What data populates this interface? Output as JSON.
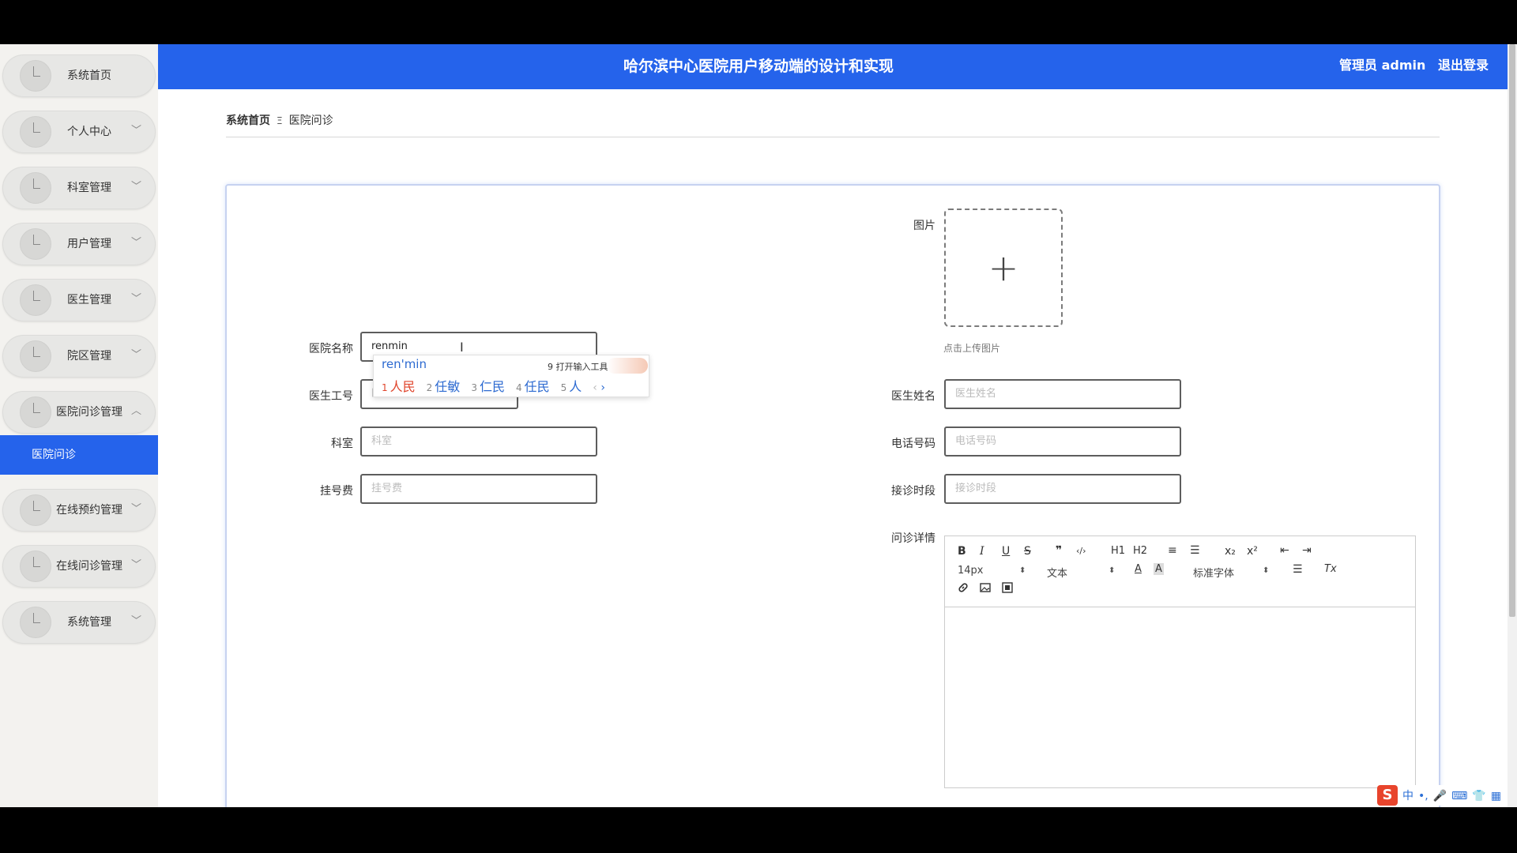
{
  "header": {
    "title": "哈尔滨中心医院用户移动端的设计和实现",
    "user": "管理员 admin",
    "logout": "退出登录"
  },
  "sidebar": {
    "items": [
      {
        "label": "系统首页",
        "chevron": ""
      },
      {
        "label": "个人中心",
        "chevron": "﹀"
      },
      {
        "label": "科室管理",
        "chevron": "﹀"
      },
      {
        "label": "用户管理",
        "chevron": "﹀"
      },
      {
        "label": "医生管理",
        "chevron": "﹀"
      },
      {
        "label": "院区管理",
        "chevron": "﹀"
      },
      {
        "label": "医院问诊管理",
        "chevron": "︿"
      },
      {
        "label": "在线预约管理",
        "chevron": "﹀"
      },
      {
        "label": "在线问诊管理",
        "chevron": "﹀"
      },
      {
        "label": "系统管理",
        "chevron": "﹀"
      }
    ],
    "active_sub": "医院问诊"
  },
  "breadcrumb": {
    "home": "系统首页",
    "separator": "Ξ",
    "current": "医院问诊"
  },
  "form": {
    "hospital_name": {
      "label": "医院名称",
      "value": "renmin"
    },
    "doctor_id": {
      "label": "医生工号",
      "placeholder": "医生工号"
    },
    "department": {
      "label": "科室",
      "placeholder": "科室"
    },
    "fee": {
      "label": "挂号费",
      "placeholder": "挂号费"
    },
    "image": {
      "label": "图片",
      "hint": "点击上传图片",
      "plus": "+"
    },
    "doctor_name": {
      "label": "医生姓名",
      "placeholder": "医生姓名"
    },
    "phone": {
      "label": "电话号码",
      "placeholder": "电话号码"
    },
    "time_slot": {
      "label": "接诊时段",
      "placeholder": "接诊时段"
    },
    "details": {
      "label": "问诊详情"
    }
  },
  "ime": {
    "pinyin": "ren'min",
    "toolbox": "9 打开输入工具箱",
    "candidates": [
      {
        "num": "1",
        "text": "人民"
      },
      {
        "num": "2",
        "text": "任敏"
      },
      {
        "num": "3",
        "text": "仁民"
      },
      {
        "num": "4",
        "text": "任民"
      },
      {
        "num": "5",
        "text": "人"
      }
    ],
    "prev": "‹",
    "next": "›"
  },
  "editor": {
    "toolbar_row1": [
      "B",
      "I",
      "U",
      "S",
      "❞",
      "‹/›",
      "H1",
      "H2",
      "≡",
      "☰",
      "x₂",
      "x²",
      "⇤",
      "⇥"
    ],
    "font_size": "14px",
    "block_type": "文本",
    "font_family": "标准字体",
    "clear_format": "Tx"
  },
  "tray": {
    "logo": "S",
    "items": [
      "中",
      "•,",
      "🎤",
      "⌨",
      "👕",
      "▦"
    ]
  }
}
